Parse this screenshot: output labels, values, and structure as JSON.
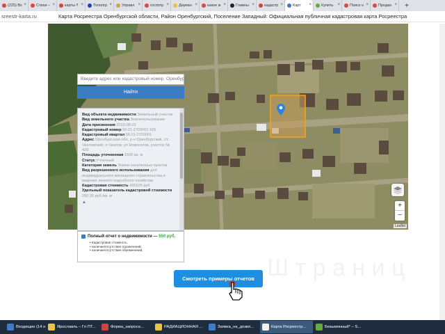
{
  "browser": {
    "tabs": [
      {
        "label": "(225) Вх",
        "color": "#d44"
      },
      {
        "label": "Стихи –",
        "color": "#d44"
      },
      {
        "label": "карты !!",
        "color": "#d44"
      },
      {
        "label": "Тополгр",
        "color": "#2244aa"
      },
      {
        "label": "Управл",
        "color": "#c8a84a"
      },
      {
        "label": "госпотр",
        "color": "#d44"
      },
      {
        "label": "Деревн",
        "color": "#e8c24a"
      },
      {
        "label": "какое ж",
        "color": "#d44"
      },
      {
        "label": "Главны",
        "color": "#222"
      },
      {
        "label": "кадастр",
        "color": "#c44"
      },
      {
        "label": "Карт",
        "color": "#3b7cc4"
      },
      {
        "label": "Купить",
        "color": "#6a4"
      },
      {
        "label": "Поиск н",
        "color": "#d44"
      },
      {
        "label": "Продан",
        "color": "#d44"
      }
    ],
    "active_tab_index": 10,
    "url": "sreestr-karta.ru",
    "page_title": "Карта Росреестра Оренбургской области, Район Оренбургский, Поселение Западный: Официальная публичная кадастровая карта Росреестра"
  },
  "search": {
    "placeholder": "Введите адрес или кадастровый номер. Оренбур",
    "button_label": "Найти"
  },
  "info": {
    "rows": [
      {
        "label": "Вид объекта недвижимости",
        "value": "Земельный участок"
      },
      {
        "label": "Вид земельного участка",
        "value": "Землепользование"
      },
      {
        "label": "Дата присвоения",
        "value": "2010-05-21"
      },
      {
        "label": "Кадастровый номер",
        "value": "56:21:2703001:165"
      },
      {
        "label": "Кадастровый квартал",
        "value": "56:21:2703001"
      },
      {
        "label": "Адрес",
        "value": "Оренбургская обл, р-н Оренбургский, с/с Чкаловский, п Чкалов, ул Новоселов, участок № 42б"
      },
      {
        "label": "Площадь уточненная",
        "value": "1500 кв. м"
      },
      {
        "label": "Статус",
        "value": "Учтенный"
      },
      {
        "label": "Категория земель",
        "value": "Земли населенных пунктов"
      },
      {
        "label": "Вид разрешенного использования",
        "value": "для индивидуального жилищного строительства и ведения личного подсобного хозяйства"
      },
      {
        "label": "Кадастровая стоимость",
        "value": "435525 руб."
      },
      {
        "label": "Удельный показатель кадастровой стоимости",
        "value": "290.35 руб./кв. м"
      }
    ]
  },
  "report": {
    "title": "Полный отчет о недвижимости —",
    "price": "550 руб.",
    "items": [
      "Кадастровая стоимость,",
      "наличие/отсутствие ограничений,",
      "наличие/отсутствие обременений,"
    ]
  },
  "cta": {
    "label": "Смотреть примеры отчетов",
    "watermark": "Ш т р а н и ц"
  },
  "map": {
    "attribution": "Leaflet",
    "zoom_in": "+",
    "zoom_out": "−",
    "marker_color": "#2b83e8",
    "parcel_color": "#f2a21a"
  },
  "taskbar": {
    "items": [
      {
        "label": "Входящие (14 не...",
        "color": "#3b7cc4"
      },
      {
        "label": "Ярославль – Гл ПТ...",
        "color": "#e8c24a"
      },
      {
        "label": "Форма_запроса...",
        "color": "#c44"
      },
      {
        "label": "РАДИАЦИОННАЯ ...",
        "color": "#e8c24a"
      },
      {
        "label": "Заявка_на_дозвл...",
        "color": "#3b7cc4"
      },
      {
        "label": "Карта Росреестр...",
        "color": "#f4f4f4"
      },
      {
        "label": "Безымянный* – S...",
        "color": "#6a4"
      }
    ],
    "active_index": 5
  }
}
